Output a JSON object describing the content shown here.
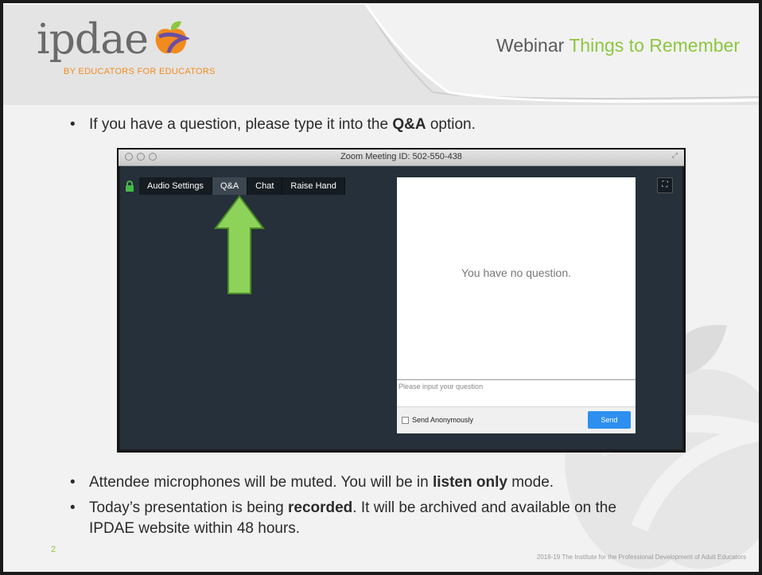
{
  "header": {
    "logo_word": "ipdae",
    "logo_tagline": "BY EDUCATORS FOR EDUCATORS",
    "title_plain": "Webinar ",
    "title_accent": "Things to Remember"
  },
  "bullets": {
    "b1_pre": "If you have a question, please type it into the ",
    "b1_bold": "Q&A",
    "b1_post": " option.",
    "b2_pre": "Attendee microphones will be muted.  You will be in ",
    "b2_bold": "listen only",
    "b2_post": " mode.",
    "b3_pre": "Today’s presentation is being ",
    "b3_bold": "recorded",
    "b3_post": ". It will be archived and available on the IPDAE website within 48 hours."
  },
  "zoom": {
    "window_title": "Zoom Meeting ID: 502-550-438",
    "toolbar": [
      "Audio Settings",
      "Q&A",
      "Chat",
      "Raise Hand"
    ],
    "active_tab": "Q&A",
    "empty_message": "You have no question.",
    "input_placeholder": "Please input your question",
    "anonymous_label": "Send Anonymously",
    "send_label": "Send"
  },
  "footer": {
    "page_number": "2",
    "copyright": "2018-19 The Institute for the Professional Development of Adult Educators"
  },
  "colors": {
    "accent_green": "#8dc63f",
    "tagline_orange": "#f28b1d",
    "send_blue": "#2d8ff0"
  }
}
